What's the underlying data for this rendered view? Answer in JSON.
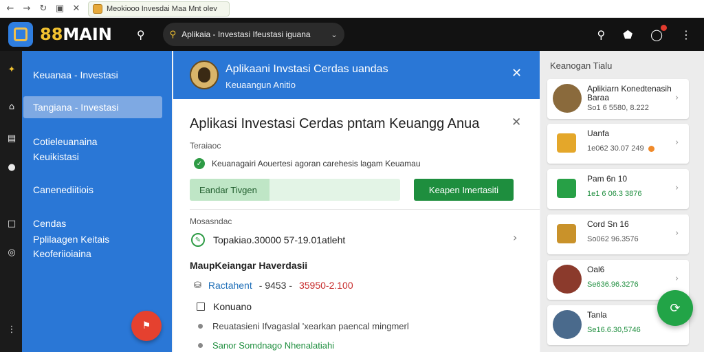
{
  "browser": {
    "nav_icons": [
      "←",
      "→",
      "↻",
      "▣",
      "✕"
    ],
    "tab_title": "Meokiooo Invesdai Maa Mnt olev",
    "right_icons": [
      "⌄",
      "⊠",
      "▤",
      "—",
      "☐",
      "✕"
    ]
  },
  "topbar": {
    "brand_a": "88",
    "brand_b": "MAIN",
    "bulb_icon": "⚲",
    "search_icon": "⚲",
    "search_text": "Aplikaia - Investasi Ifeustasi iguana",
    "search_caret": "⌄",
    "icons": {
      "search": "⚲",
      "shield": "⬟",
      "chat": "◯",
      "more": "⋮"
    }
  },
  "rail": {
    "icons": [
      "✦",
      "⌂",
      "▤",
      "●",
      "□",
      "◎",
      "⋮"
    ]
  },
  "sidebar": {
    "items": [
      "Keuanaa - Investasi",
      "Tangiana - Investasi",
      "Cotieleuanaina",
      "Keuikistasi",
      "Canenediitiois",
      "Cendas",
      "Pplilaagen Keitais",
      "Keoferiioiaina"
    ],
    "fab_icon": "⚑"
  },
  "dialog": {
    "head_title": "Aplikaani Invstasi Cerdas uandas",
    "head_sub": "Keuaangun Anitio",
    "close_icon": "✕",
    "title": "Aplikasi Investasi Cerdas pntam Keuangg Anua",
    "label1": "Teraiaoc",
    "check_icon": "✓",
    "check_text": "Keuanagairi Aouertesi agoran carehesis lagam Keuamau",
    "progress_label": "Eandar Tivgen",
    "progress_value": 0.38,
    "action_button": "Keapen Imertasiti",
    "label2": "Mosasndac",
    "row_icon": "✎",
    "row_text": "Topakiao.30000 57-19.01atleht",
    "row_chevron": "›",
    "section_head": "MaupKeiangar Haverdasii",
    "price_icon": "⛁",
    "price_a": "Ractahent",
    "price_b": "- 9453 -",
    "price_c": "35950-2.100",
    "checkbox_label": "Konuano",
    "bullets": [
      {
        "text": "Reuatasieni Ifvagaslal 'xearkan paencal mingmerl",
        "color": "#444444"
      },
      {
        "text": "Sanor Somdnago Nhenalatiahi",
        "color": "#1e8e3e"
      }
    ]
  },
  "right_panel": {
    "title": "Keanogan Tialu",
    "cards": [
      {
        "name": "Aplikiarn Konedtenasih Baraa",
        "value": "So1 6 5580, 8.222",
        "value_color": "#555555",
        "thumb": "#8a6a3c",
        "square": false,
        "coin": false
      },
      {
        "name": "Uanfa",
        "value": "1e062 30.07 249",
        "value_color": "#555555",
        "thumb": "#e4a72a",
        "square": true,
        "coin": true
      },
      {
        "name": "Pam 6n 10",
        "value": "1e1 6 06.3 3876",
        "value_color": "#1e8e3e",
        "thumb": "#27a046",
        "square": true,
        "coin": false
      },
      {
        "name": "Cord Sn 16",
        "value": "So062 96.3576",
        "value_color": "#555555",
        "thumb": "#c9922a",
        "square": true,
        "coin": false
      },
      {
        "name": "Oal6",
        "value": "Se636.96.3276",
        "value_color": "#1e8e3e",
        "thumb": "#8b3a2c",
        "square": false,
        "coin": false
      },
      {
        "name": "Tanla",
        "value": "Se16.6.30,5746",
        "value_color": "#1e8e3e",
        "thumb": "#4a6a8c",
        "square": false,
        "coin": false
      }
    ],
    "chevron": "›",
    "fab_icon": "⟳"
  }
}
